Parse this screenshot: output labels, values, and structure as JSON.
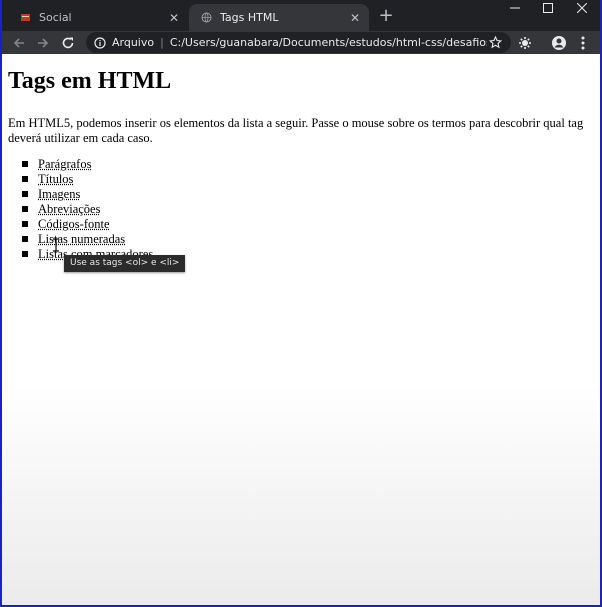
{
  "browser": {
    "tabs": [
      {
        "label": "Social",
        "icon": "social-favicon-icon",
        "active": false
      },
      {
        "label": "Tags HTML",
        "icon": "globe-icon",
        "active": true
      }
    ],
    "omnibox": {
      "site_label": "Arquivo",
      "separator": "|",
      "url": "C:/Users/guanabara/Documents/estudos/html-css/desafios/d006/in..."
    }
  },
  "page": {
    "title": "Tags em HTML",
    "intro": "Em HTML5, podemos inserir os elementos da lista a seguir. Passe o mouse sobre os termos para descobrir qual tag deverá utilizar em cada caso.",
    "items": [
      {
        "label": "Parágrafos"
      },
      {
        "label": "Títulos"
      },
      {
        "label": "Imagens"
      },
      {
        "label": "Abreviações"
      },
      {
        "label": "Códigos-fonte"
      },
      {
        "label": "Listas numeradas"
      },
      {
        "label": "Listas com marcadores"
      }
    ],
    "tooltip": "Use as tags <ol> e <li>"
  },
  "colors": {
    "tabstrip": "#202124",
    "toolbar": "#35363a",
    "frame_border": "#1e22b8"
  }
}
